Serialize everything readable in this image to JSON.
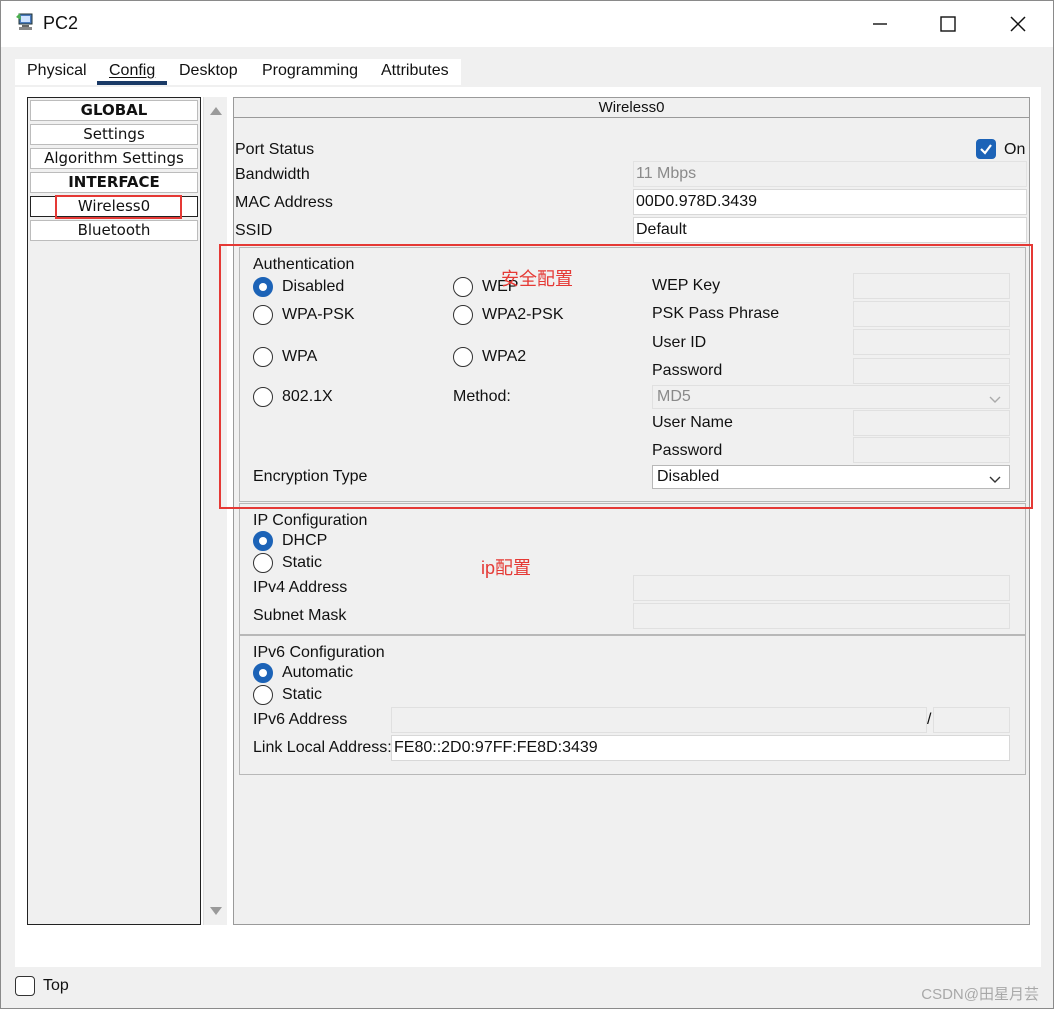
{
  "window": {
    "title": "PC2",
    "controls": {
      "minimize": "minimize-icon",
      "maximize": "maximize-icon",
      "close": "close-icon"
    }
  },
  "tabs": [
    {
      "label": "Physical",
      "active": false
    },
    {
      "label": "Config",
      "active": true
    },
    {
      "label": "Desktop",
      "active": false
    },
    {
      "label": "Programming",
      "active": false
    },
    {
      "label": "Attributes",
      "active": false
    }
  ],
  "sidebar": {
    "items": [
      {
        "label": "GLOBAL",
        "type": "header"
      },
      {
        "label": "Settings",
        "type": "item"
      },
      {
        "label": "Algorithm Settings",
        "type": "item"
      },
      {
        "label": "INTERFACE",
        "type": "header"
      },
      {
        "label": "Wireless0",
        "type": "item",
        "selected": true
      },
      {
        "label": "Bluetooth",
        "type": "item"
      }
    ]
  },
  "panel": {
    "title": "Wireless0",
    "port_status": {
      "label": "Port Status",
      "checkbox_label": "On",
      "checked": true
    },
    "bandwidth": {
      "label": "Bandwidth",
      "value": "11 Mbps"
    },
    "mac": {
      "label": "MAC Address",
      "value": "00D0.978D.3439"
    },
    "ssid": {
      "label": "SSID",
      "value": "Default"
    },
    "auth": {
      "title": "Authentication",
      "options": {
        "disabled": "Disabled",
        "wep": "WEP",
        "wpa_psk": "WPA-PSK",
        "wpa2_psk": "WPA2-PSK",
        "wpa": "WPA",
        "wpa2": "WPA2",
        "dot1x": "802.1X"
      },
      "selected": "Disabled",
      "method_label": "Method:",
      "method_value": "MD5",
      "wep_key_label": "WEP Key",
      "psk_label": "PSK Pass Phrase",
      "user_id_label": "User ID",
      "password_label": "Password",
      "user_name_label": "User Name",
      "password2_label": "Password",
      "encryption_label": "Encryption Type",
      "encryption_value": "Disabled"
    },
    "ip": {
      "title": "IP Configuration",
      "dhcp": "DHCP",
      "static": "Static",
      "selected": "DHCP",
      "ipv4_label": "IPv4 Address",
      "mask_label": "Subnet Mask"
    },
    "ipv6": {
      "title": "IPv6 Configuration",
      "automatic": "Automatic",
      "static": "Static",
      "selected": "Automatic",
      "address_label": "IPv6 Address",
      "slash": "/",
      "link_local_label": "Link Local Address:",
      "link_local_value": "FE80::2D0:97FF:FE8D:3439"
    }
  },
  "annotations": {
    "security": "安全配置",
    "ip": "ip配置",
    "accent": "#e53935"
  },
  "footer": {
    "top_label": "Top",
    "checked": false
  },
  "watermark": "CSDN@田星月芸"
}
